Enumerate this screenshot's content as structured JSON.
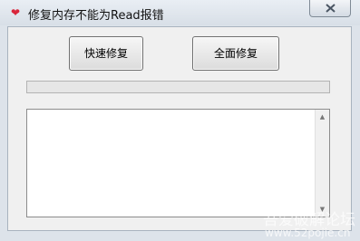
{
  "window": {
    "title": "修复内存不能为Read报错",
    "icon": "heart-icon"
  },
  "buttons": {
    "quick_repair": "快速修复",
    "full_repair": "全面修复"
  },
  "progress": {
    "value": 0
  },
  "log": {
    "text": ""
  },
  "watermark": {
    "line1": "吾爱破解论坛",
    "line2": "www.52pojie.cn"
  },
  "colors": {
    "icon": "#d9263b",
    "client_bg": "#f0f0f0",
    "progress_fill": "#4fb34f"
  }
}
